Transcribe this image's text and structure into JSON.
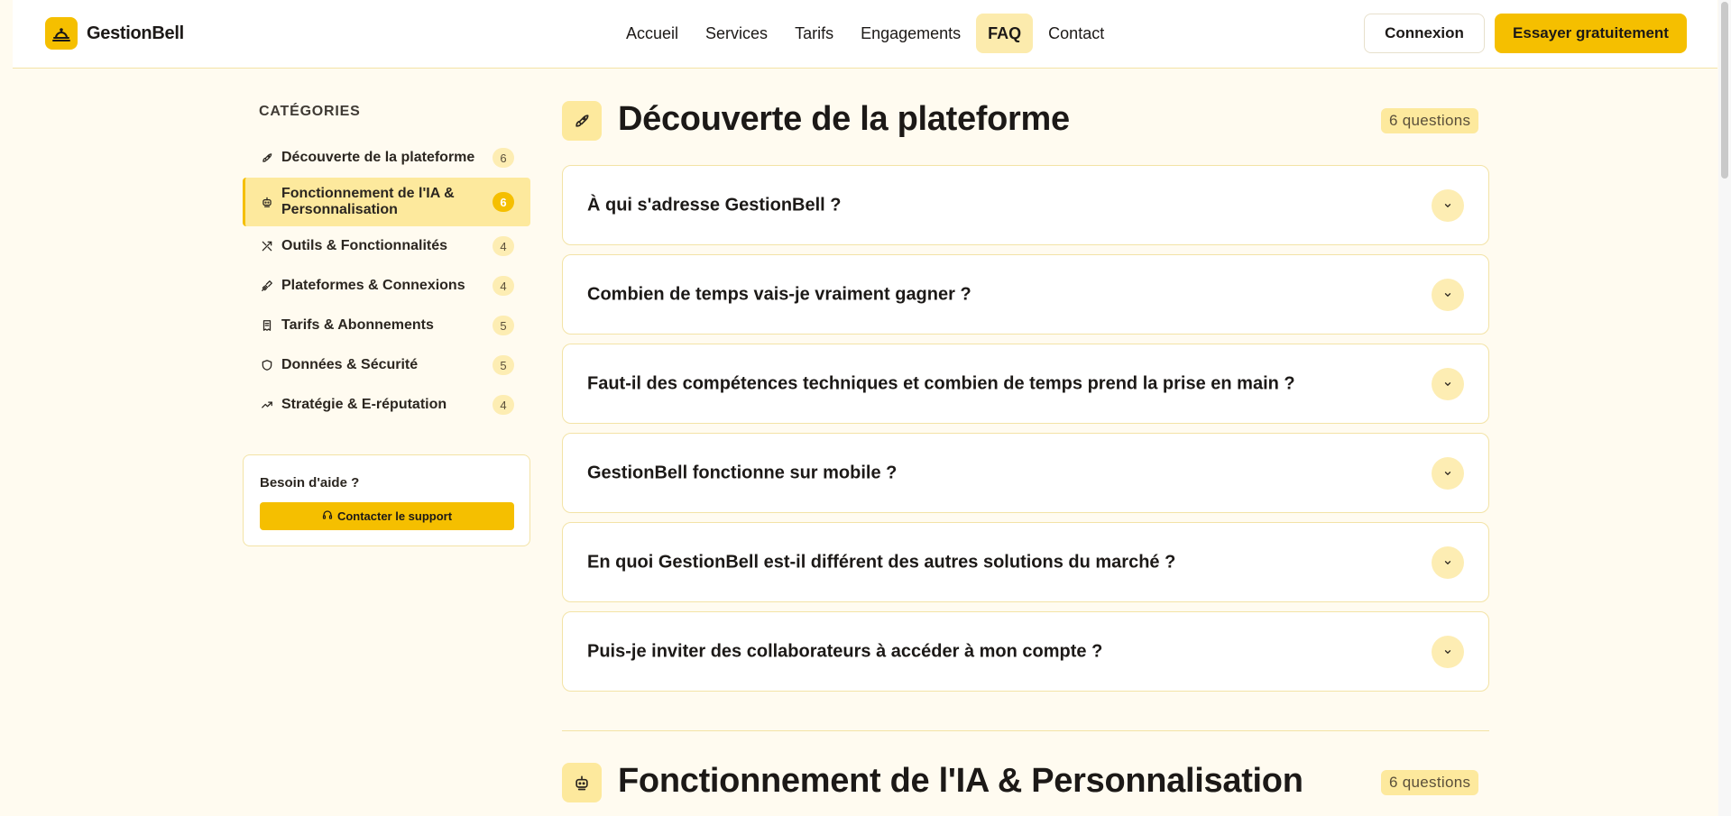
{
  "header": {
    "brand": "GestionBell",
    "nav": [
      {
        "label": "Accueil",
        "active": false
      },
      {
        "label": "Services",
        "active": false
      },
      {
        "label": "Tarifs",
        "active": false
      },
      {
        "label": "Engagements",
        "active": false
      },
      {
        "label": "FAQ",
        "active": true
      },
      {
        "label": "Contact",
        "active": false
      }
    ],
    "login_label": "Connexion",
    "cta_label": "Essayer gratuitement"
  },
  "sidebar": {
    "heading": "CATÉGORIES",
    "items": [
      {
        "icon": "rocket-icon",
        "label": "Découverte de la plateforme",
        "count": "6",
        "active": false
      },
      {
        "icon": "bot-icon",
        "label": "Fonctionnement de l'IA & Personnalisation",
        "count": "6",
        "active": true
      },
      {
        "icon": "tools-icon",
        "label": "Outils & Fonctionnalités",
        "count": "4",
        "active": false
      },
      {
        "icon": "plug-icon",
        "label": "Plateformes & Connexions",
        "count": "4",
        "active": false
      },
      {
        "icon": "receipt-icon",
        "label": "Tarifs & Abonnements",
        "count": "5",
        "active": false
      },
      {
        "icon": "shield-icon",
        "label": "Données & Sécurité",
        "count": "5",
        "active": false
      },
      {
        "icon": "trending-up-icon",
        "label": "Stratégie & E-réputation",
        "count": "4",
        "active": false
      }
    ],
    "help": {
      "title": "Besoin d'aide ?",
      "button_label": "Contacter le support",
      "button_icon": "headset-icon"
    }
  },
  "main": {
    "sections": [
      {
        "icon": "rocket-icon",
        "title": "Découverte de la plateforme",
        "badge": "6 questions",
        "questions": [
          "À qui s'adresse GestionBell ?",
          "Combien de temps vais-je vraiment gagner ?",
          "Faut-il des compétences techniques et combien de temps prend la prise en main ?",
          "GestionBell fonctionne sur mobile ?",
          "En quoi GestionBell est-il différent des autres solutions du marché ?",
          "Puis-je inviter des collaborateurs à accéder à mon compte ?"
        ]
      },
      {
        "icon": "bot-icon",
        "title": "Fonctionnement de l'IA & Personnalisation",
        "badge": "6 questions",
        "questions": []
      }
    ]
  },
  "colors": {
    "accent": "#f5bf00",
    "accent_light": "#fde99d",
    "background": "#fffbf0",
    "border": "#f3e3a6",
    "text": "#1c1917"
  }
}
